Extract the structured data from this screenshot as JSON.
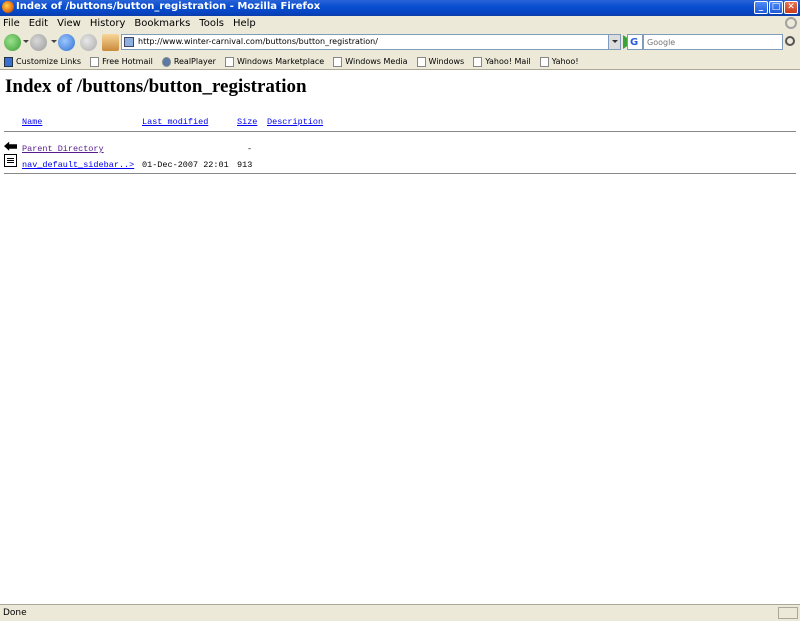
{
  "window": {
    "title": "Index of /buttons/button_registration - Mozilla Firefox",
    "minimize": "_",
    "maximize": "□",
    "close": "✕"
  },
  "menu": [
    "File",
    "Edit",
    "View",
    "History",
    "Bookmarks",
    "Tools",
    "Help"
  ],
  "navigation": {
    "url": "http://www.winter-carnival.com/buttons/button_registration/",
    "search_placeholder": "Google",
    "search_engine_glyph": "G"
  },
  "bookmarks": [
    {
      "label": "Customize Links",
      "icon": "msn-icon"
    },
    {
      "label": "Free Hotmail",
      "icon": "page-icon"
    },
    {
      "label": "RealPlayer",
      "icon": "realplayer-icon"
    },
    {
      "label": "Windows Marketplace",
      "icon": "page-icon"
    },
    {
      "label": "Windows Media",
      "icon": "page-icon"
    },
    {
      "label": "Windows",
      "icon": "page-icon"
    },
    {
      "label": "Yahoo! Mail",
      "icon": "page-icon"
    },
    {
      "label": "Yahoo!",
      "icon": "page-icon"
    }
  ],
  "page": {
    "heading": "Index of /buttons/button_registration",
    "columns": {
      "name": "Name",
      "last_modified": "Last modified",
      "size": "Size",
      "description": "Description"
    },
    "rows": [
      {
        "name": "Parent Directory",
        "modified": "",
        "size": "-",
        "icon": "back-icon"
      },
      {
        "name": "nav_default_sidebar..>",
        "modified": "01-Dec-2007 22:01",
        "size": "913",
        "icon": "text-file-icon"
      }
    ]
  },
  "status": {
    "text": "Done"
  }
}
